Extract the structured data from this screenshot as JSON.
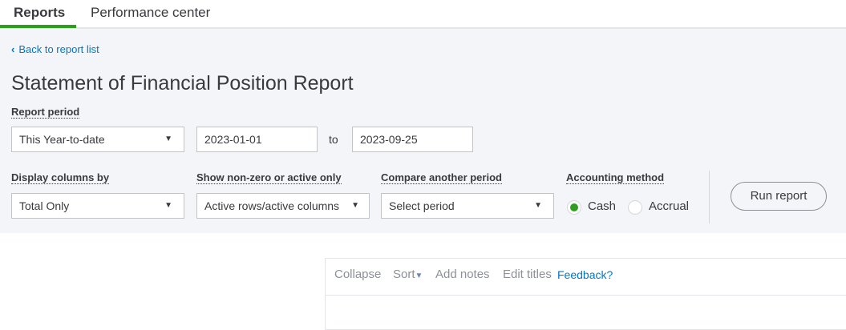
{
  "tabs": [
    {
      "label": "Reports",
      "active": true
    },
    {
      "label": "Performance center",
      "active": false
    }
  ],
  "back_link": "Back to report list",
  "title": "Statement of Financial Position Report",
  "report_period": {
    "label": "Report period",
    "value": "This Year-to-date",
    "from": "2023-01-01",
    "to_label": "to",
    "to": "2023-09-25"
  },
  "display_columns": {
    "label": "Display columns by",
    "value": "Total Only"
  },
  "non_zero": {
    "label": "Show non-zero or active only",
    "value": "Active rows/active columns"
  },
  "compare": {
    "label": "Compare another period",
    "placeholder": "Select period"
  },
  "accounting": {
    "label": "Accounting method",
    "options": [
      "Cash",
      "Accrual"
    ],
    "selected": "Cash"
  },
  "run_report": "Run report",
  "toolbar": {
    "collapse": "Collapse",
    "sort": "Sort",
    "add_notes": "Add notes",
    "edit_titles": "Edit titles",
    "feedback": "Feedback?"
  },
  "colors": {
    "accent_green": "#2ca01c",
    "link_blue": "#0077c5"
  }
}
